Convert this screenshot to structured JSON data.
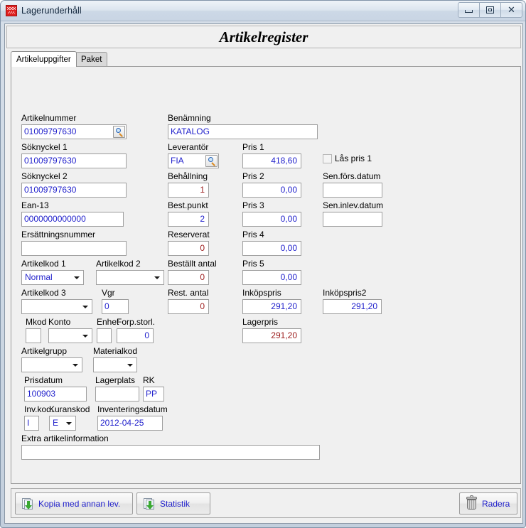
{
  "window": {
    "title": "Lagerunderhåll",
    "icon": "app-icon",
    "minimize_glyph": "minimize-icon",
    "maximize_glyph": "maximize-icon",
    "close_glyph": "✕"
  },
  "header": {
    "title": "Artikelregister"
  },
  "tabs": [
    {
      "label": "Artikeluppgifter",
      "active": true
    },
    {
      "label": "Paket",
      "active": false
    }
  ],
  "form": {
    "artikelnummer": {
      "label": "Artikelnummer",
      "value": "01009797630"
    },
    "soknyckel1": {
      "label": "Söknyckel 1",
      "value": "01009797630"
    },
    "soknyckel2": {
      "label": "Söknyckel 2",
      "value": "01009797630"
    },
    "ean13": {
      "label": "Ean-13",
      "value": "0000000000000"
    },
    "ersattningsnummer": {
      "label": "Ersättningsnummer",
      "value": ""
    },
    "artikelkod1": {
      "label": "Artikelkod 1",
      "value": "Normal"
    },
    "artikelkod2": {
      "label": "Artikelkod 2",
      "value": ""
    },
    "artikelkod3": {
      "label": "Artikelkod 3",
      "value": ""
    },
    "vgr": {
      "label": "Vgr",
      "value": "0"
    },
    "mkod": {
      "label": "Mkod",
      "value": ""
    },
    "konto": {
      "label": "Konto",
      "value": ""
    },
    "enhet": {
      "label": "Enhet",
      "value": ""
    },
    "forp_storl": {
      "label": "Forp.storl.",
      "value": "0"
    },
    "artikelgrupp": {
      "label": "Artikelgrupp",
      "value": ""
    },
    "materialkod": {
      "label": "Materialkod",
      "value": ""
    },
    "prisdatum": {
      "label": "Prisdatum",
      "value": "100903"
    },
    "lagerplats": {
      "label": "Lagerplats",
      "value": ""
    },
    "rk": {
      "label": "RK",
      "value": "PP"
    },
    "inv_kod": {
      "label": "Inv.kod.",
      "value": "I"
    },
    "kuranskod": {
      "label": "Kuranskod",
      "value": "E"
    },
    "inventeringsdatum": {
      "label": "Inventeringsdatum",
      "value": "2012-04-25"
    },
    "extra_artikelinfo": {
      "label": "Extra artikelinformation",
      "value": ""
    },
    "benamning": {
      "label": "Benämning",
      "value": "KATALOG"
    },
    "leverantor": {
      "label": "Leverantör",
      "value": "FIA"
    },
    "behallning": {
      "label": "Behållning",
      "value": "1"
    },
    "best_punkt": {
      "label": "Best.punkt",
      "value": "2"
    },
    "reserverat": {
      "label": "Reserverat",
      "value": "0"
    },
    "bestallt_antal": {
      "label": "Beställt antal",
      "value": "0"
    },
    "rest_antal": {
      "label": "Rest. antal",
      "value": "0"
    },
    "pris1": {
      "label": "Pris 1",
      "value": "418,60"
    },
    "pris2": {
      "label": "Pris 2",
      "value": "0,00"
    },
    "pris3": {
      "label": "Pris 3",
      "value": "0,00"
    },
    "pris4": {
      "label": "Pris 4",
      "value": "0,00"
    },
    "pris5": {
      "label": "Pris 5",
      "value": "0,00"
    },
    "inkopspris": {
      "label": "Inköpspris",
      "value": "291,20"
    },
    "lagerpris": {
      "label": "Lagerpris",
      "value": "291,20"
    },
    "inkopspris2": {
      "label": "Inköpspris2",
      "value": "291,20"
    },
    "las_pris1": {
      "label": "Lås pris 1",
      "checked": false
    },
    "sen_fors_datum": {
      "label": "Sen.förs.datum",
      "value": ""
    },
    "sen_inlev_datum": {
      "label": "Sen.inlev.datum",
      "value": ""
    }
  },
  "buttons": {
    "kopia": {
      "label": "Kopia med annan lev.",
      "icon": "copy-document-icon"
    },
    "statistik": {
      "label": "Statistik",
      "icon": "copy-document-icon"
    },
    "radera": {
      "label": "Radera",
      "icon": "trash-icon"
    }
  },
  "colors": {
    "value_blue": "#2222cc",
    "value_red": "#9c1b1b",
    "window_bg": "#f0f0f0",
    "accent": "#e02020"
  }
}
